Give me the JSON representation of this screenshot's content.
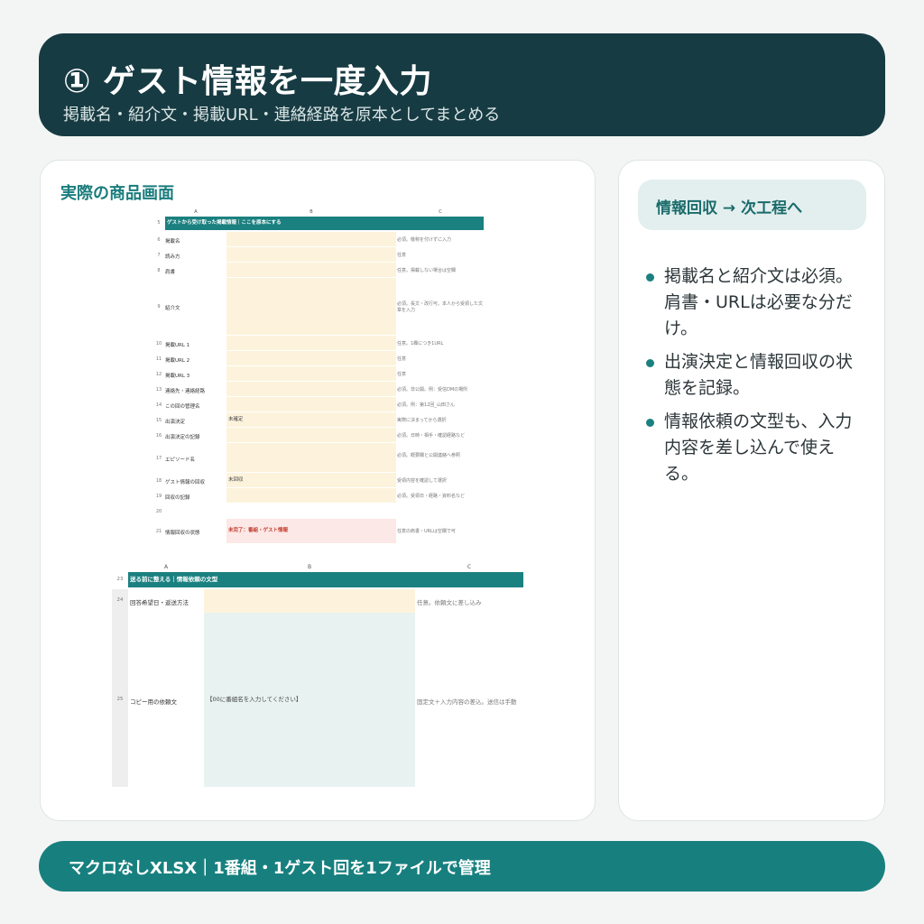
{
  "header": {
    "title": "① ゲスト情報を一度入力",
    "subtitle": "掲載名・紹介文・掲載URL・連絡経路を原本としてまとめる"
  },
  "left_card": {
    "title": "実際の商品画面"
  },
  "sheet1": {
    "columns": [
      "A",
      "B",
      "C"
    ],
    "banner": {
      "row": "5",
      "text": "ゲストから受け取った掲載情報｜ここを原本にする"
    },
    "rows": [
      {
        "row": "6",
        "label": "掲載名",
        "value": "",
        "note": "必須。敬称を付けずに入力"
      },
      {
        "row": "7",
        "label": "読み方",
        "value": "",
        "note": "任意"
      },
      {
        "row": "8",
        "label": "肩書",
        "value": "",
        "note": "任意。掲載しない場合は空欄"
      },
      {
        "row": "9",
        "label": "紹介文",
        "value": "",
        "note": "必須。長文・改行可。本人から受領した文章を入力"
      },
      {
        "row": "10",
        "label": "掲載URL 1",
        "value": "",
        "note": "任意。1欄につき1URL"
      },
      {
        "row": "11",
        "label": "掲載URL 2",
        "value": "",
        "note": "任意"
      },
      {
        "row": "12",
        "label": "掲載URL 3",
        "value": "",
        "note": "任意"
      },
      {
        "row": "13",
        "label": "連絡先・連絡経路",
        "value": "",
        "note": "必須。非公開。例：受信DMの場所"
      },
      {
        "row": "14",
        "label": "この回の管理名",
        "value": "",
        "note": "必須。例：第12回_山田さん"
      },
      {
        "row": "15",
        "label": "出演決定",
        "value": "未確定",
        "note": "実際に決まってから選択"
      },
      {
        "row": "16",
        "label": "出演決定の記録",
        "value": "",
        "note": "必須。日時・相手・確認経路など"
      },
      {
        "row": "17",
        "label": "エピソード名",
        "value": "",
        "note": "必須。概要欄と公開連絡へ参照"
      },
      {
        "row": "18",
        "label": "ゲスト情報の回収",
        "value": "未回収",
        "note": "受領内容を確認して選択"
      },
      {
        "row": "19",
        "label": "回収の記録",
        "value": "",
        "note": "必須。受領日・経路・資料名など"
      },
      {
        "row": "20",
        "label": "",
        "value": "",
        "note": ""
      },
      {
        "row": "21",
        "label": "情報回収の状態",
        "value": "未完了：番組・ゲスト情報",
        "note": "任意の肩書・URLは空欄で可"
      }
    ]
  },
  "sheet2": {
    "columns": [
      "A",
      "B",
      "C"
    ],
    "banner": {
      "row": "23",
      "text": "送る前に整える｜情報依頼の文型"
    },
    "rows": [
      {
        "row": "24",
        "label": "回答希望日・返送方法",
        "value": "",
        "note": "任意。依頼文に差し込み"
      },
      {
        "row": "25",
        "label": "コピー用の依頼文",
        "value": "【00に番組名を入力してください】",
        "note": "固定文＋入力内容の差込。送信は手動"
      }
    ]
  },
  "right_card": {
    "cta": "情報回収 → 次工程へ",
    "bullets": [
      "掲載名と紹介文は必須。肩書・URLは必要な分だけ。",
      "出演決定と情報回収の状態を記録。",
      "情報依頼の文型も、入力内容を差し込んで使える。"
    ]
  },
  "footer": {
    "text": "マクロなしXLSX｜1番組・1ゲスト回を1ファイルで管理"
  },
  "colors": {
    "header_bg": "#173b43",
    "accent": "#1b8080",
    "input_fill": "#fdf3dc",
    "status_fill": "#fce8e6",
    "template_fill": "#e8f2f0"
  }
}
